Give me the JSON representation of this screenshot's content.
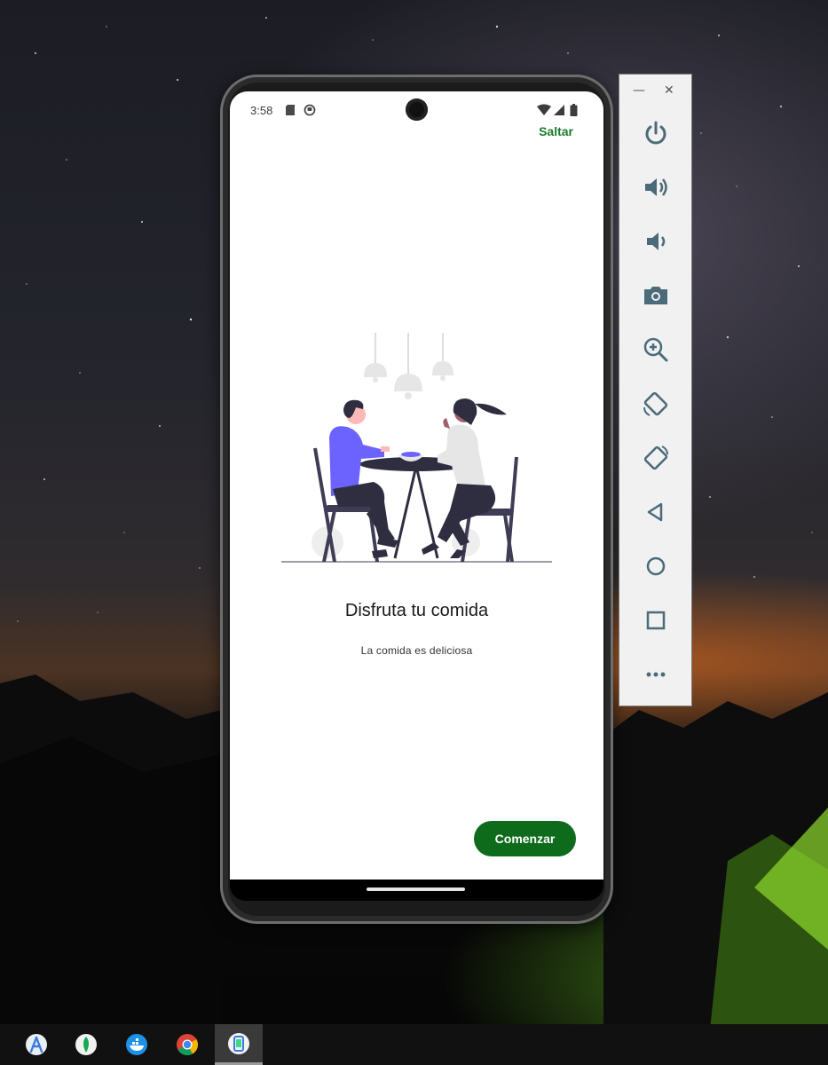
{
  "statusbar": {
    "time": "3:58",
    "icons": [
      "sd-card-icon",
      "app-notification-icon",
      "wifi-icon",
      "signal-icon",
      "battery-icon"
    ]
  },
  "onboarding": {
    "skip_label": "Saltar",
    "title": "Disfruta tu comida",
    "subtitle": "La comida es deliciosa",
    "start_label": "Comenzar",
    "illustration": "two-people-dining-illustration"
  },
  "colors": {
    "accent_green": "#0e6b1c",
    "skip_green": "#1b7a2b",
    "person_shirt": "#6c63ff",
    "toolbar_icon": "#4b6b7a"
  },
  "emulator_toolbar": {
    "window_controls": [
      "minimize-icon",
      "close-icon"
    ],
    "buttons": [
      "power-icon",
      "volume-up-icon",
      "volume-down-icon",
      "camera-icon",
      "zoom-in-icon",
      "rotate-left-icon",
      "rotate-right-icon",
      "back-icon",
      "home-icon",
      "overview-icon",
      "more-icon"
    ]
  },
  "taskbar": {
    "apps": [
      "android-studio-icon",
      "mongodb-compass-icon",
      "docker-icon",
      "chrome-icon",
      "emulator-icon"
    ],
    "active": "emulator-icon"
  }
}
